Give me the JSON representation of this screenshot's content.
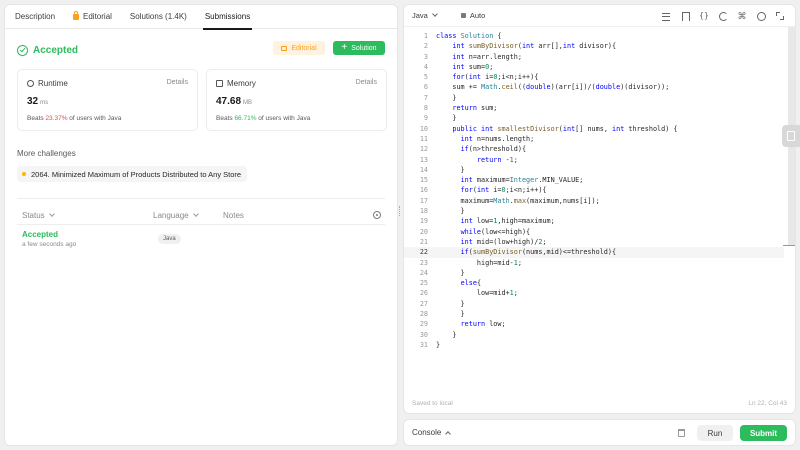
{
  "tabs": [
    "Description",
    "Editorial",
    "Solutions (1.4K)",
    "Submissions"
  ],
  "result": {
    "title": "Accepted",
    "editorial_label": "Editorial",
    "solution_label": "Solution"
  },
  "runtime": {
    "label": "Runtime",
    "details": "Details",
    "value": "32",
    "unit": "ms",
    "beats_prefix": "Beats ",
    "beats_pct": "23.37%",
    "beats_suffix": " of users with Java"
  },
  "memory": {
    "label": "Memory",
    "details": "Details",
    "value": "47.68",
    "unit": "MB",
    "beats_prefix": "Beats ",
    "beats_pct": "66.71%",
    "beats_suffix": " of users with Java"
  },
  "challenges": {
    "heading": "More challenges",
    "item": "2064. Minimized Maximum of Products Distributed to Any Store"
  },
  "submissions": {
    "col_status": "Status",
    "col_language": "Language",
    "col_notes": "Notes",
    "rows": [
      {
        "status": "Accepted",
        "time": "a few seconds ago",
        "language": "Java"
      }
    ]
  },
  "editor": {
    "language": "Java",
    "mode": "Auto",
    "saved": "Saved to local",
    "cursor": "Ln 22, Col 43",
    "highlight_line": 22,
    "lines": [
      "class Solution {",
      "    int sumByDivisor(int arr[],int divisor){",
      "    int n=arr.length;",
      "    int sum=0;",
      "    for(int i=0;i<n;i++){",
      "    sum += Math.ceil((double)(arr[i])/(double)(divisor));",
      "    }",
      "    return sum;",
      "    }",
      "    public int smallestDivisor(int[] nums, int threshold) {",
      "      int n=nums.length;",
      "      if(n>threshold){",
      "          return -1;",
      "      }",
      "      int maximum=Integer.MIN_VALUE;",
      "      for(int i=0;i<n;i++){",
      "      maximum=Math.max(maximum,nums[i]);",
      "      }",
      "      int low=1,high=maximum;",
      "      while(low<=high){",
      "      int mid=(low+high)/2;",
      "      if(sumByDivisor(nums,mid)<=threshold){",
      "          high=mid-1;",
      "      }",
      "      else{",
      "          low=mid+1;",
      "      }",
      "      }",
      "      return low;",
      "    }",
      "}"
    ]
  },
  "bottom": {
    "console": "Console",
    "run": "Run",
    "submit": "Submit"
  }
}
